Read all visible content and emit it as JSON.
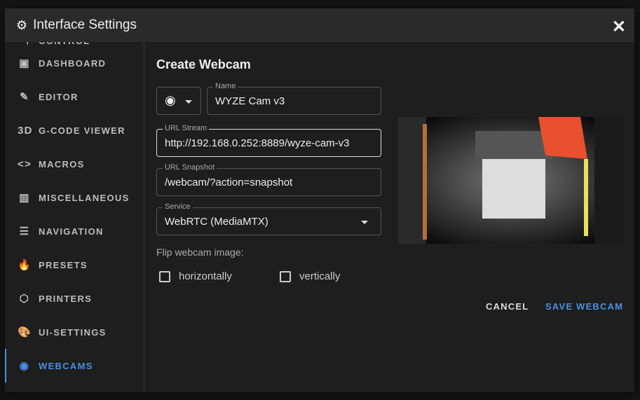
{
  "dialog": {
    "title": "Interface Settings",
    "title_icon": "cogs-icon",
    "close_icon": "close-icon"
  },
  "sidebar": {
    "items": [
      {
        "label": "CONTROL",
        "icon": "tune-icon",
        "glyph": "⊣"
      },
      {
        "label": "DASHBOARD",
        "icon": "monitor-dashboard-icon",
        "glyph": "▣"
      },
      {
        "label": "EDITOR",
        "icon": "file-edit-icon",
        "glyph": "✎"
      },
      {
        "label": "G-CODE VIEWER",
        "icon": "3d-icon",
        "glyph": "3D"
      },
      {
        "label": "MACROS",
        "icon": "code-tags-icon",
        "glyph": "<>"
      },
      {
        "label": "MISCELLANEOUS",
        "icon": "miscellaneous-icon",
        "glyph": "▥"
      },
      {
        "label": "NAVIGATION",
        "icon": "menu-icon",
        "glyph": "☰"
      },
      {
        "label": "PRESETS",
        "icon": "fire-icon",
        "glyph": "🔥"
      },
      {
        "label": "PRINTERS",
        "icon": "printer-3d-icon",
        "glyph": "⬡"
      },
      {
        "label": "UI-SETTINGS",
        "icon": "palette-icon",
        "glyph": "🎨"
      },
      {
        "label": "WEBCAMS",
        "icon": "webcam-icon",
        "glyph": "◉",
        "active": true
      }
    ]
  },
  "form": {
    "title": "Create Webcam",
    "icon_select": "webcam-icon",
    "name": {
      "label": "Name",
      "value": "WYZE Cam v3"
    },
    "url_stream": {
      "label": "URL Stream",
      "value": "http://192.168.0.252:8889/wyze-cam-v3"
    },
    "url_snapshot": {
      "label": "URL Snapshot",
      "value": "/webcam/?action=snapshot"
    },
    "service": {
      "label": "Service",
      "value": "WebRTC (MediaMTX)"
    },
    "flip_label": "Flip webcam image:",
    "flip_horizontal": {
      "label": "horizontally",
      "checked": false
    },
    "flip_vertical": {
      "label": "vertically",
      "checked": false
    },
    "cancel": "CANCEL",
    "save": "SAVE WEBCAM"
  },
  "colors": {
    "accent": "#4a90e2"
  }
}
